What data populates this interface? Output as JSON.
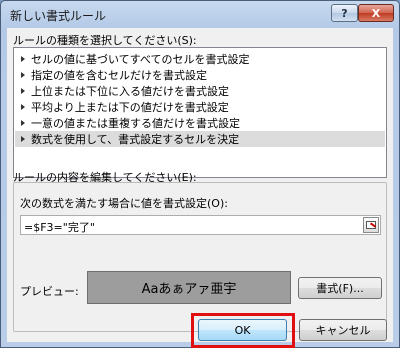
{
  "window": {
    "title": "新しい書式ルール",
    "help_label": "?",
    "close_label": "X"
  },
  "rule_type": {
    "label": "ルールの種類を選択してください(S):",
    "items": [
      "セルの値に基づいてすべてのセルを書式設定",
      "指定の値を含むセルだけを書式設定",
      "上位または下位に入る値だけを書式設定",
      "平均より上または下の値だけを書式設定",
      "一意の値または重複する値だけを書式設定",
      "数式を使用して、書式設定するセルを決定"
    ],
    "selected_index": 5
  },
  "rule_edit": {
    "label": "ルールの内容を編集してください(E):",
    "formula_label": "次の数式を満たす場合に値を書式設定(O):",
    "formula_value": "=$F3=\"完了\"",
    "preview_label": "プレビュー:",
    "preview_text": "Aaあぁアァ亜宇",
    "preview_fill": "#9d9d9d",
    "format_button": "書式(F)..."
  },
  "footer": {
    "ok_label": "OK",
    "cancel_label": "キャンセル",
    "highlight_color": "#e01010"
  }
}
